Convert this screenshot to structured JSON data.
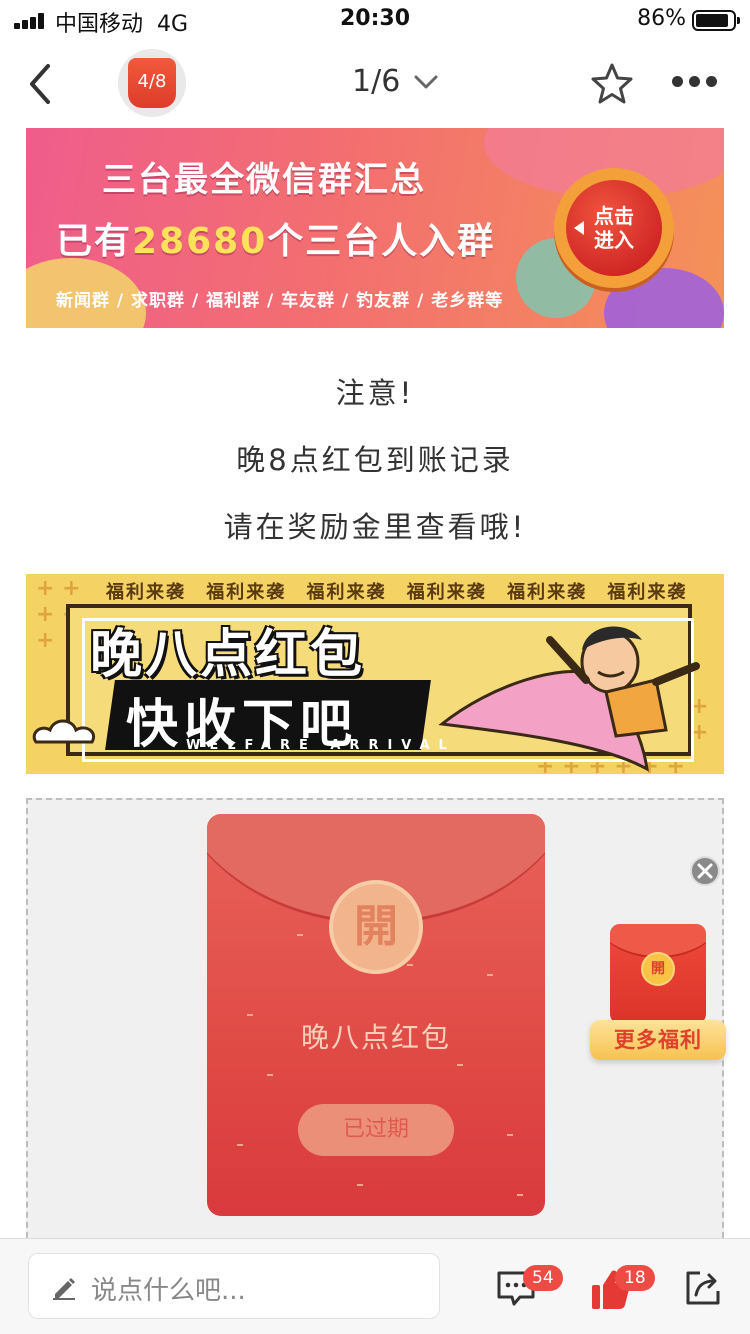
{
  "status_bar": {
    "carrier": "中国移动",
    "network": "4G",
    "time": "20:30",
    "battery": "86%"
  },
  "nav": {
    "badge": "4/8",
    "pager": "1/6"
  },
  "banner_groups": {
    "title": "三台最全微信群汇总",
    "subtitle_prefix": "已有",
    "subtitle_number": "28680",
    "subtitle_suffix": "个三台人入群",
    "tags": "新闻群 / 求职群 / 福利群 / 车友群 / 钓友群 / 老乡群等",
    "button_line1": "点击",
    "button_line2": "进入"
  },
  "notice": {
    "line1": "注意!",
    "line2": "晚8点红包到账记录",
    "line3": "请在奖励金里查看哦!"
  },
  "banner_welfare": {
    "top_row": "福利来袭 福利来袭 福利来袭 福利来袭 福利来袭 福利来袭",
    "line1": "晚八点红包",
    "line2": "快收下吧",
    "english": "WELFARE ARRIVAL"
  },
  "red_packet": {
    "seal": "開",
    "title": "晚八点红包",
    "button": "已过期"
  },
  "float_widget": {
    "seal": "開",
    "label": "更多福利"
  },
  "bottom_bar": {
    "placeholder": "说点什么吧...",
    "comment_count": "54",
    "like_count": "18"
  },
  "icons": {
    "back": "back-arrow-icon",
    "star": "star-icon",
    "more": "more-icon",
    "pencil": "pencil-icon",
    "chat": "chat-icon",
    "thumb": "thumbs-up-icon",
    "share": "share-icon",
    "close": "close-icon"
  },
  "colors": {
    "accent_red": "#e04a45",
    "badge_red": "#ef4b45",
    "gold": "#f6c24f"
  }
}
